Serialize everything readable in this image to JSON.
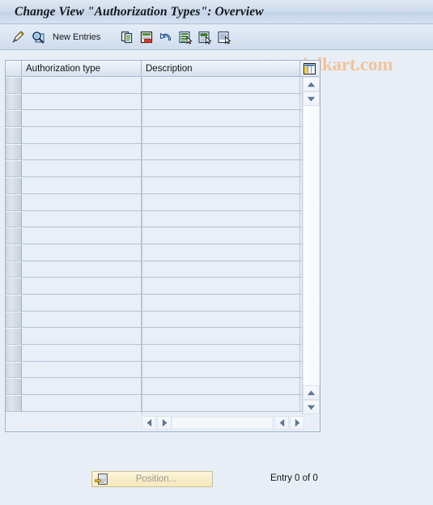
{
  "window": {
    "title": "Change View \"Authorization Types\": Overview"
  },
  "toolbar": {
    "new_entries_label": "New Entries",
    "items": [
      {
        "name": "display-change-icon",
        "icon": "pencil-magnifier"
      },
      {
        "name": "check-entries-icon",
        "icon": "magnifier-check"
      },
      {
        "name": "copy-as-icon",
        "icon": "copy-document"
      },
      {
        "name": "delete-icon",
        "icon": "document-delete"
      },
      {
        "name": "undo-icon",
        "icon": "undo-arrow"
      },
      {
        "name": "select-all-icon",
        "icon": "document-select-all"
      },
      {
        "name": "deselect-all-icon",
        "icon": "document-deselect-all"
      },
      {
        "name": "select-block-icon",
        "icon": "document-select-block"
      }
    ]
  },
  "watermark": {
    "text": "www.tutorialkart.com",
    "color": "#f0c49a"
  },
  "table": {
    "columns": [
      {
        "key": "selector",
        "label": ""
      },
      {
        "key": "authorization_type",
        "label": "Authorization type"
      },
      {
        "key": "description",
        "label": "Description"
      }
    ],
    "config_icon": "table-settings-icon",
    "rows": [],
    "empty_row_count": 20
  },
  "scrollbars": {
    "vertical": {
      "up_arrow": "▲",
      "down_arrow": "▼"
    },
    "horizontal": {
      "left_arrow": "◀",
      "right_arrow": "▶"
    }
  },
  "footer": {
    "position_button_label": "Position...",
    "entry_status": "Entry 0 of 0"
  },
  "colors": {
    "background": "#e8eef6",
    "title_gradient_top": "#dfe9f5",
    "title_gradient_bottom": "#c3d4e8",
    "panel_border": "#9db4cc",
    "cell_background": "#e9eff7",
    "position_button": "#f8edc8"
  }
}
